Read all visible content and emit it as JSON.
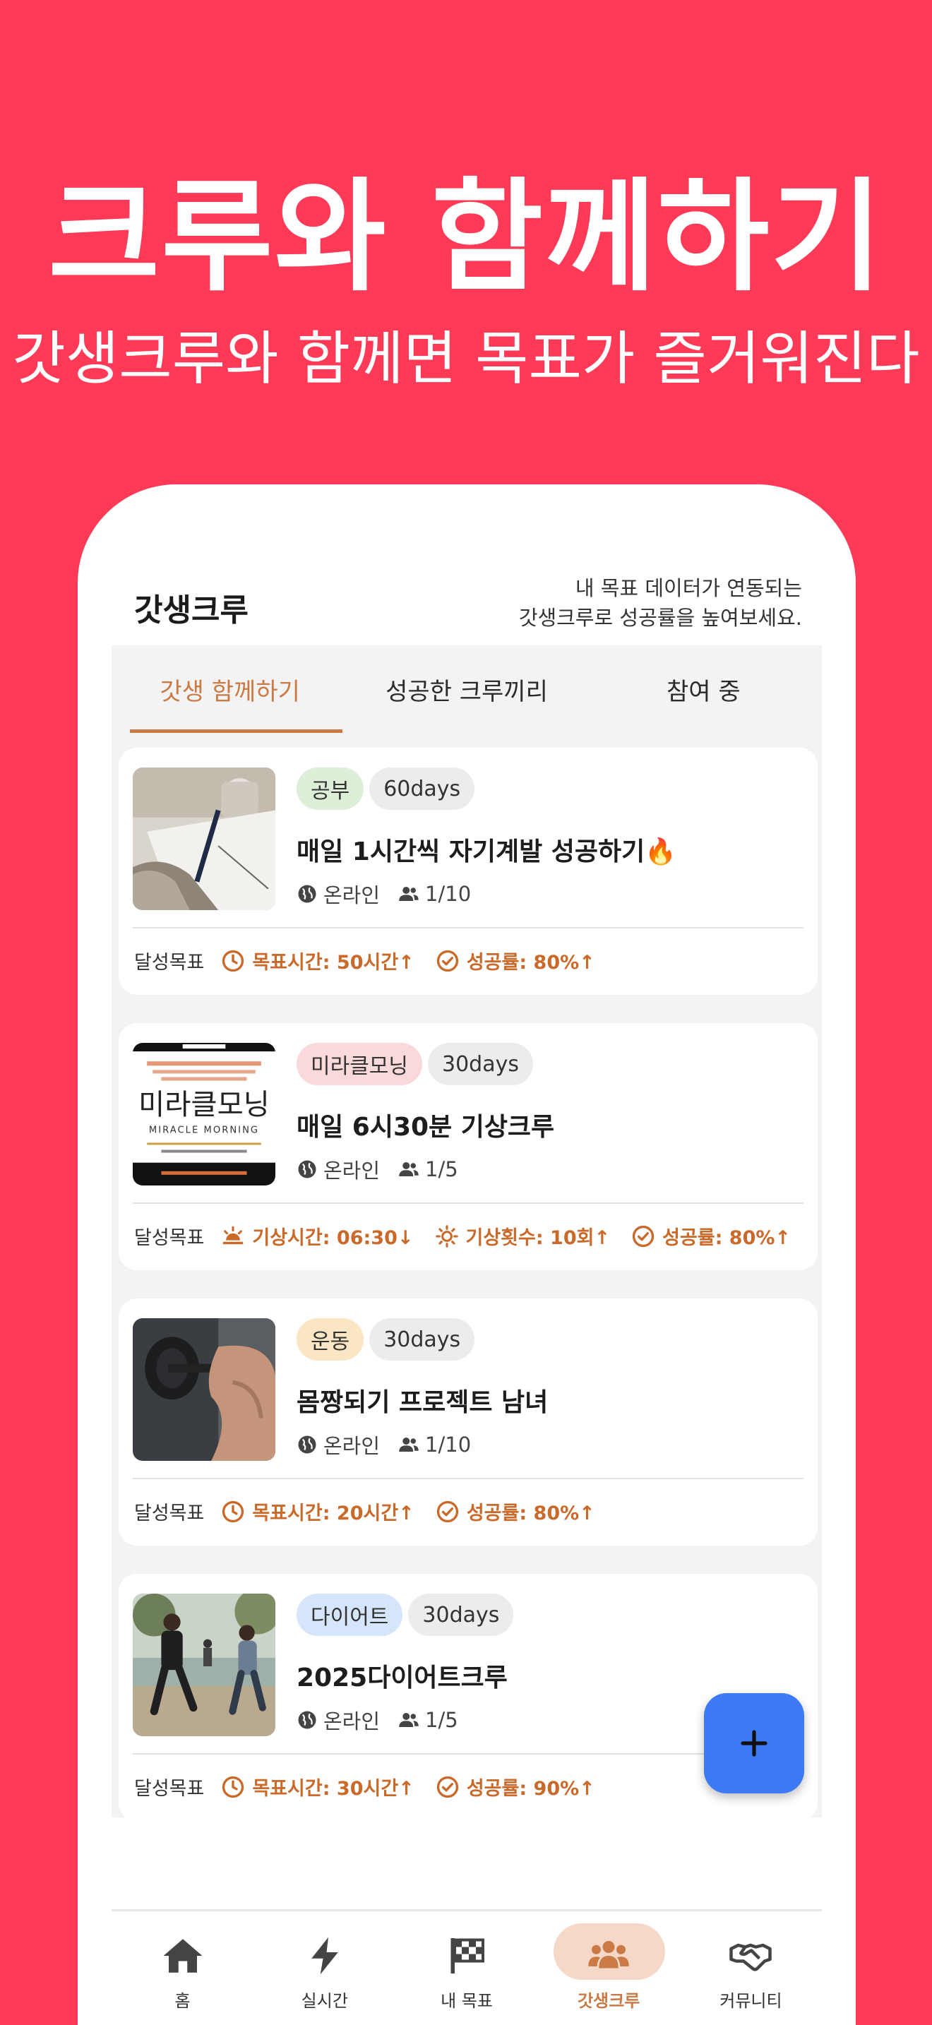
{
  "hero": {
    "title": "크루와 함께하기",
    "subtitle": "갓생크루와 함께면 목표가 즐거워진다"
  },
  "header": {
    "title": "갓생크루",
    "desc_line1": "내 목표 데이터가 연동되는",
    "desc_line2": "갓생크루로 성공률을 높여보세요."
  },
  "tabs": [
    {
      "label": "갓생 함께하기",
      "active": true
    },
    {
      "label": "성공한 크루끼리",
      "active": false
    },
    {
      "label": "참여 중",
      "active": false
    }
  ],
  "cards": [
    {
      "category": "공부",
      "category_color": "#DDEFD9",
      "days": "60days",
      "title": "매일 1시간씩 자기계발 성공하기🔥",
      "location": "온라인",
      "members": "1/10",
      "goal_label": "달성목표",
      "goals": [
        {
          "icon": "clock-icon",
          "text": "목표시간: 50시간↑"
        },
        {
          "icon": "check-circle-icon",
          "text": "성공률: 80%↑"
        }
      ]
    },
    {
      "category": "미라클모닝",
      "category_color": "#F9D9DA",
      "days": "30days",
      "title": "매일 6시30분 기상크루",
      "location": "온라인",
      "members": "1/5",
      "goal_label": "달성목표",
      "book_title": "미라클모닝",
      "book_subtitle": "MIRACLE MORNING",
      "goals": [
        {
          "icon": "sunrise-icon",
          "text": "기상시간: 06:30↓"
        },
        {
          "icon": "sun-icon",
          "text": "기상횟수: 10회↑"
        },
        {
          "icon": "check-circle-icon",
          "text": "성공률: 80%↑"
        }
      ]
    },
    {
      "category": "운동",
      "category_color": "#FBE6C4",
      "days": "30days",
      "title": "몸짱되기 프로젝트 남녀",
      "location": "온라인",
      "members": "1/10",
      "goal_label": "달성목표",
      "goals": [
        {
          "icon": "clock-icon",
          "text": "목표시간: 20시간↑"
        },
        {
          "icon": "check-circle-icon",
          "text": "성공률: 80%↑"
        }
      ]
    },
    {
      "category": "다이어트",
      "category_color": "#D5E6FA",
      "days": "30days",
      "title": "2025다이어트크루",
      "location": "온라인",
      "members": "1/5",
      "goal_label": "달성목표",
      "goals": [
        {
          "icon": "clock-icon",
          "text": "목표시간: 30시간↑"
        },
        {
          "icon": "check-circle-icon",
          "text": "성공률: 90%↑"
        }
      ]
    }
  ],
  "fab": {
    "icon": "plus-icon"
  },
  "nav": [
    {
      "label": "홈",
      "icon": "home-icon",
      "active": false
    },
    {
      "label": "실시간",
      "icon": "bolt-icon",
      "active": false
    },
    {
      "label": "내 목표",
      "icon": "checkered-flag-icon",
      "active": false
    },
    {
      "label": "갓생크루",
      "icon": "group-icon",
      "active": true
    },
    {
      "label": "커뮤니티",
      "icon": "handshake-icon",
      "active": false
    }
  ],
  "colors": {
    "background": "#FF3A57",
    "accent": "#C97A45",
    "goal_text": "#C96A2A",
    "fab": "#3C7BF5"
  }
}
